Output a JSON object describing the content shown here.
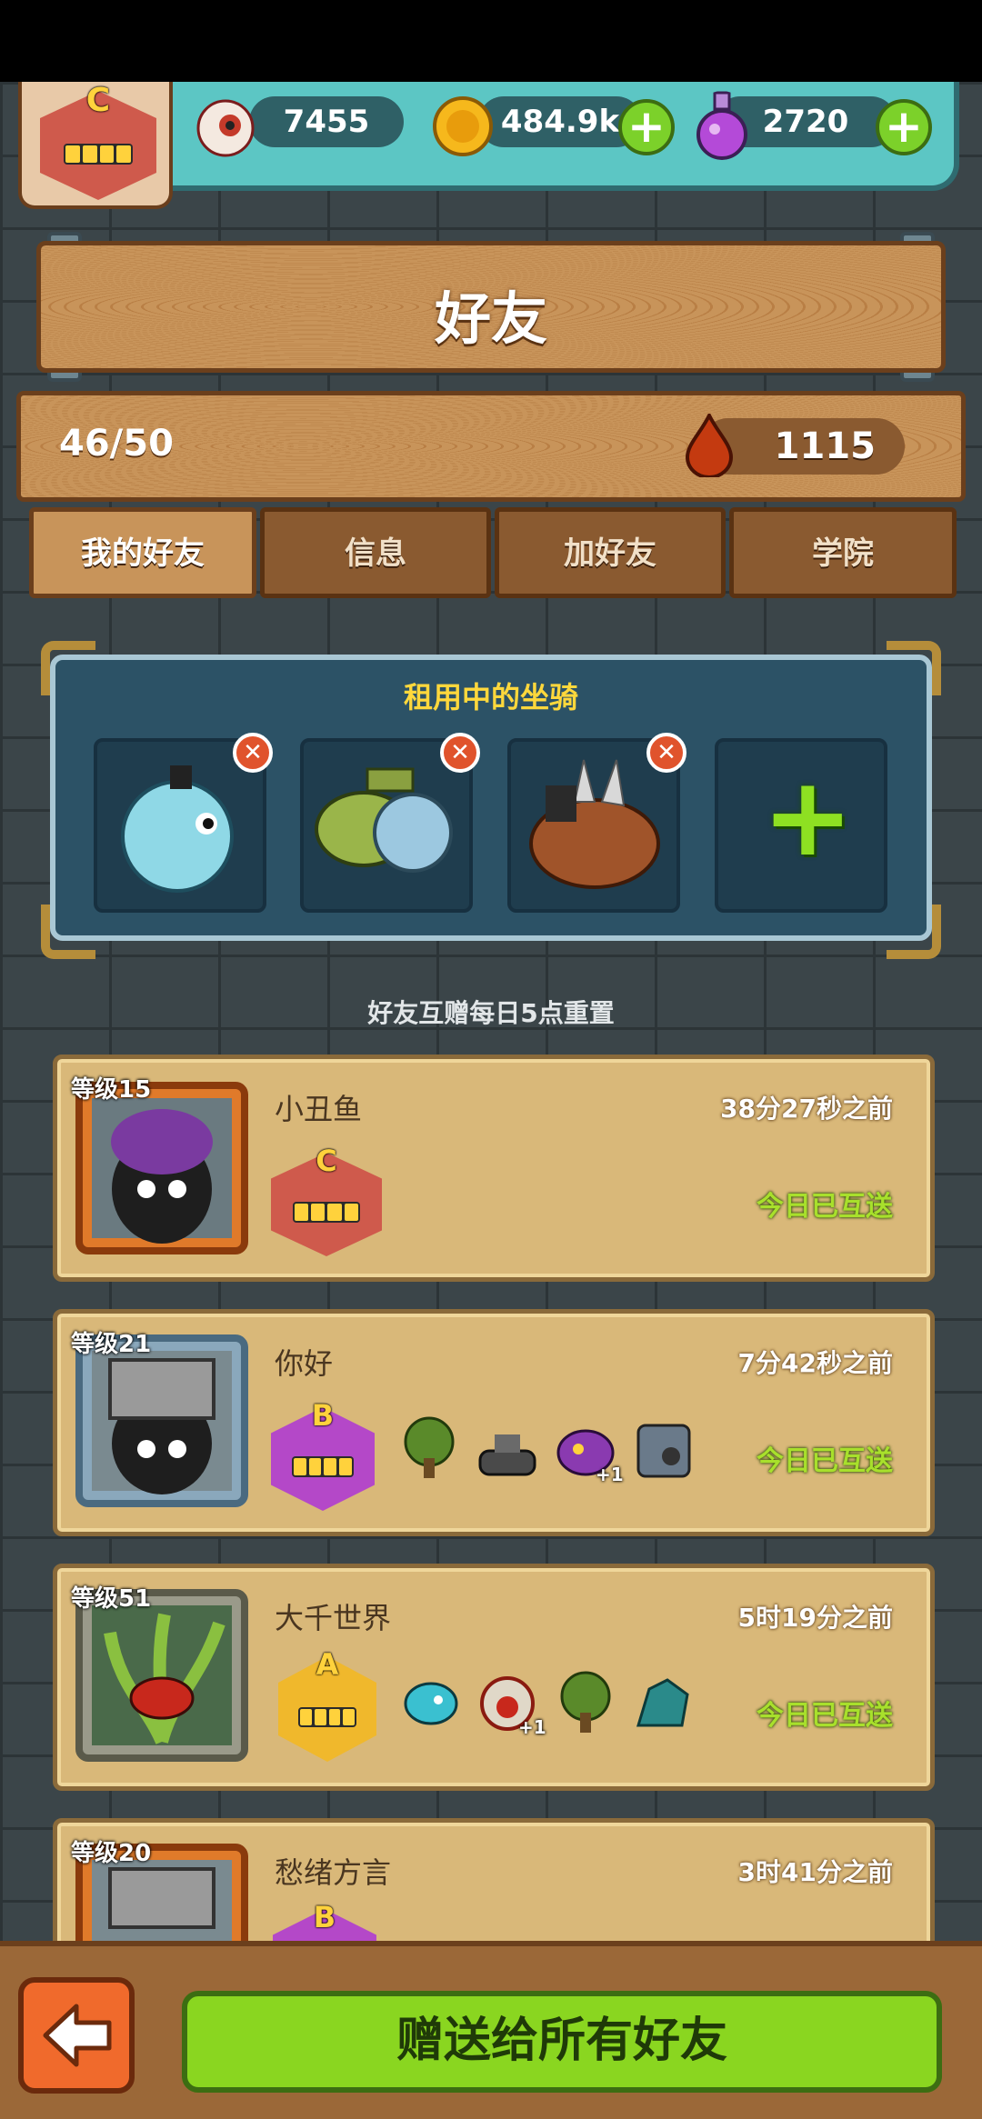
{
  "resources": {
    "eyes": "7455",
    "coins": "484.9k",
    "potions": "2720"
  },
  "player_rank": "C",
  "header": {
    "title": "好友"
  },
  "friends_count": "46/50",
  "blood": "1115",
  "tabs": [
    {
      "label": "我的好友",
      "active": true
    },
    {
      "label": "信息",
      "active": false
    },
    {
      "label": "加好友",
      "active": false
    },
    {
      "label": "学院",
      "active": false
    }
  ],
  "mounts": {
    "title": "租用中的坐骑",
    "slots": [
      "pufferfish-mount",
      "submarine-mount",
      "spiked-boar-mount",
      "add-mount"
    ]
  },
  "reset_note": "好友互赠每日5点重置",
  "friends": [
    {
      "level": "等级15",
      "name": "小丑鱼",
      "time": "38分27秒之前",
      "rank": "C",
      "status": "今日已互送",
      "units": []
    },
    {
      "level": "等级21",
      "name": "你好",
      "time": "7分42秒之前",
      "rank": "B",
      "status": "今日已互送",
      "units": [
        "tree",
        "tank",
        "demon",
        "machine"
      ],
      "plus": "+1"
    },
    {
      "level": "等级51",
      "name": "大千世界",
      "time": "5时19分之前",
      "rank": "A",
      "status": "今日已互送",
      "units": [
        "fish",
        "lion",
        "tree",
        "dragon"
      ],
      "plus": "+1"
    },
    {
      "level": "等级20",
      "name": "愁绪方言",
      "time": "3时41分之前",
      "rank": "B",
      "status": "",
      "units": []
    }
  ],
  "footer": {
    "gift_all": "赠送给所有好友"
  },
  "colors": {
    "accent_green": "#8ad620",
    "wood": "#c8945a",
    "panel_blue": "#2c5266"
  }
}
